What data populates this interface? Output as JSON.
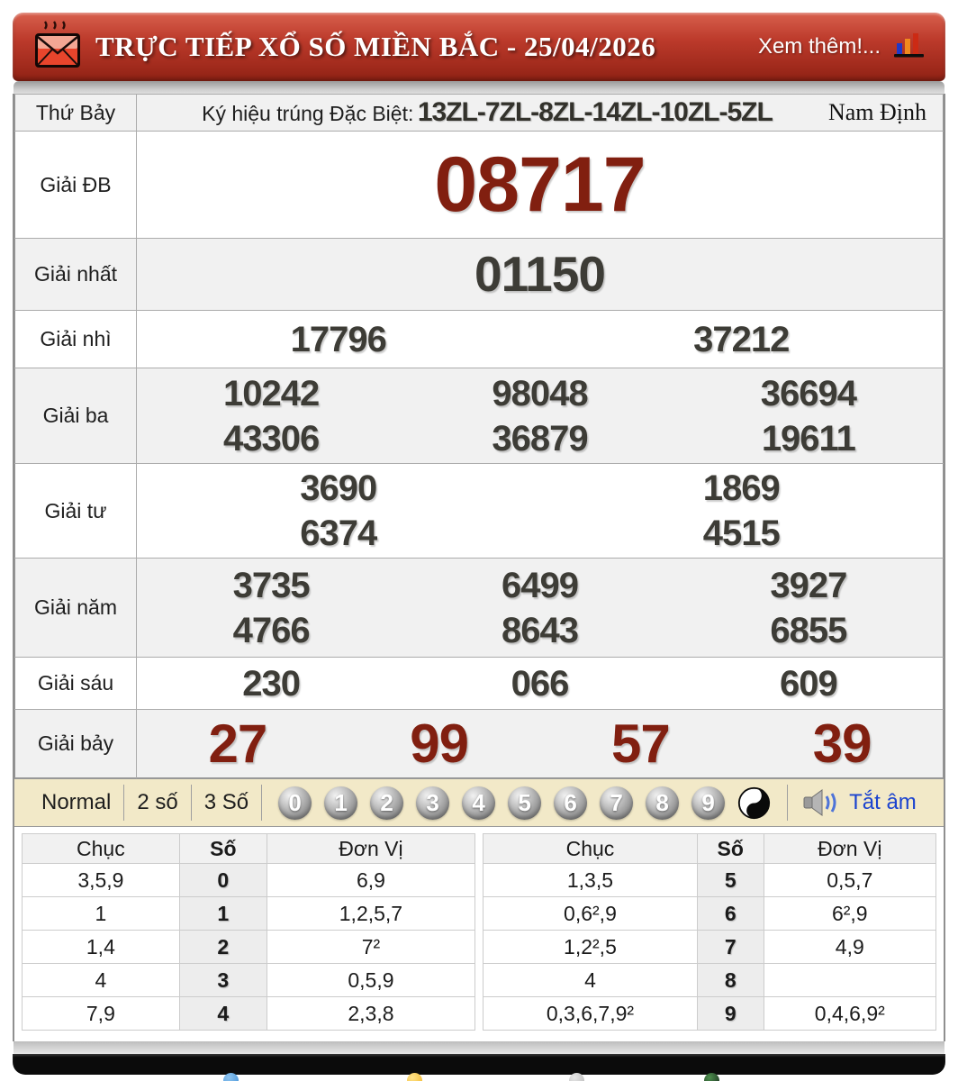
{
  "header": {
    "title": "TRỰC TIẾP XỔ SỐ MIỀN BẮC - 25/04/2026",
    "more_link": "Xem thêm!...",
    "icons": {
      "envelope": "hot-envelope-icon",
      "chart": "bar-chart-icon",
      "speaker": "speaker-icon",
      "yinyang": "yin-yang-icon"
    },
    "colors": {
      "bar_red": "#a02a1c",
      "accent_red": "#811f10",
      "link_blue": "#1b43cf",
      "bar_beige": "#f2e9c8"
    }
  },
  "info_row": {
    "day": "Thứ Bảy",
    "sign_label": "Ký hiệu trúng Đặc Biệt:",
    "sign_codes": "13ZL-7ZL-8ZL-14ZL-10ZL-5ZL",
    "province": "Nam Định"
  },
  "prizes": [
    {
      "label": "Giải ĐB",
      "numbers": [
        "08717"
      ]
    },
    {
      "label": "Giải nhất",
      "numbers": [
        "01150"
      ]
    },
    {
      "label": "Giải nhì",
      "numbers": [
        "17796",
        "37212"
      ]
    },
    {
      "label": "Giải ba",
      "numbers": [
        "10242",
        "98048",
        "36694",
        "43306",
        "36879",
        "19611"
      ]
    },
    {
      "label": "Giải tư",
      "numbers": [
        "3690",
        "1869",
        "6374",
        "4515"
      ]
    },
    {
      "label": "Giải năm",
      "numbers": [
        "3735",
        "6499",
        "3927",
        "4766",
        "8643",
        "6855"
      ]
    },
    {
      "label": "Giải sáu",
      "numbers": [
        "230",
        "066",
        "609"
      ]
    },
    {
      "label": "Giải bảy",
      "numbers": [
        "27",
        "99",
        "57",
        "39"
      ]
    }
  ],
  "controls": {
    "modes": [
      "Normal",
      "2 số",
      "3 Số"
    ],
    "balls": [
      "0",
      "1",
      "2",
      "3",
      "4",
      "5",
      "6",
      "7",
      "8",
      "9"
    ],
    "mute_label": "Tắt âm"
  },
  "digit_tables": [
    {
      "headers": [
        "Chục",
        "Số",
        "Đơn Vị"
      ],
      "rows": [
        [
          "3,5,9",
          "0",
          "6,9"
        ],
        [
          "1",
          "1",
          "1,2,5,7"
        ],
        [
          "1,4",
          "2",
          "7²"
        ],
        [
          "4",
          "3",
          "0,5,9"
        ],
        [
          "7,9",
          "4",
          "2,3,8"
        ]
      ]
    },
    {
      "headers": [
        "Chục",
        "Số",
        "Đơn Vị"
      ],
      "rows": [
        [
          "1,3,5",
          "5",
          "0,5,7"
        ],
        [
          "0,6²,9",
          "6",
          "6²,9"
        ],
        [
          "1,2²,5",
          "7",
          "4,9"
        ],
        [
          "4",
          "8",
          ""
        ],
        [
          "0,3,6,7,9²",
          "9",
          "0,4,6,9²"
        ]
      ]
    }
  ]
}
